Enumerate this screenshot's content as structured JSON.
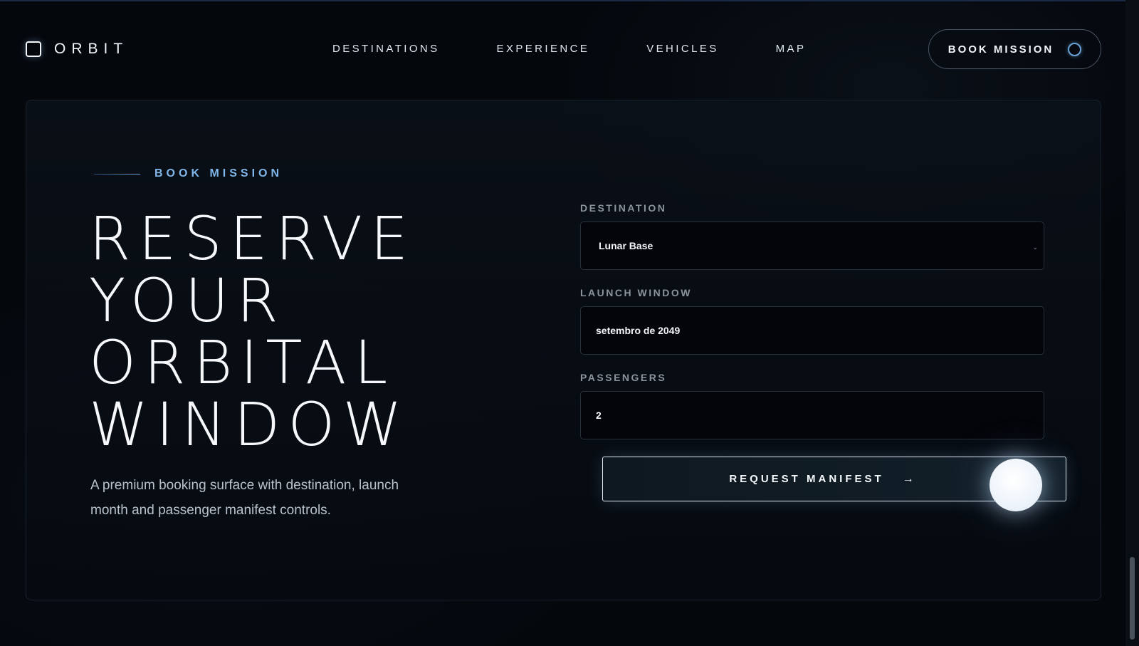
{
  "brand": {
    "name": "ORBIT"
  },
  "nav": {
    "items": [
      {
        "label": "DESTINATIONS"
      },
      {
        "label": "EXPERIENCE"
      },
      {
        "label": "VEHICLES"
      },
      {
        "label": "MAP"
      }
    ],
    "cta_label": "BOOK MISSION"
  },
  "hero": {
    "eyebrow": "BOOK MISSION",
    "title_lines": [
      "RESERVE",
      "YOUR",
      "ORBITAL",
      "WINDOW"
    ],
    "subtitle": "A premium booking surface with destination, launch month and passenger manifest controls."
  },
  "form": {
    "destination": {
      "label": "DESTINATION",
      "value": "Lunar Base",
      "caret": "⌄"
    },
    "launch_window": {
      "label": "LAUNCH WINDOW",
      "value": "setembro de 2049"
    },
    "passengers": {
      "label": "PASSENGERS",
      "value": "2"
    },
    "submit_label": "REQUEST MANIFEST",
    "submit_arrow": "→"
  },
  "colors": {
    "accent": "#7fb6ea",
    "background": "#04070c",
    "card_border": "#18212c"
  }
}
